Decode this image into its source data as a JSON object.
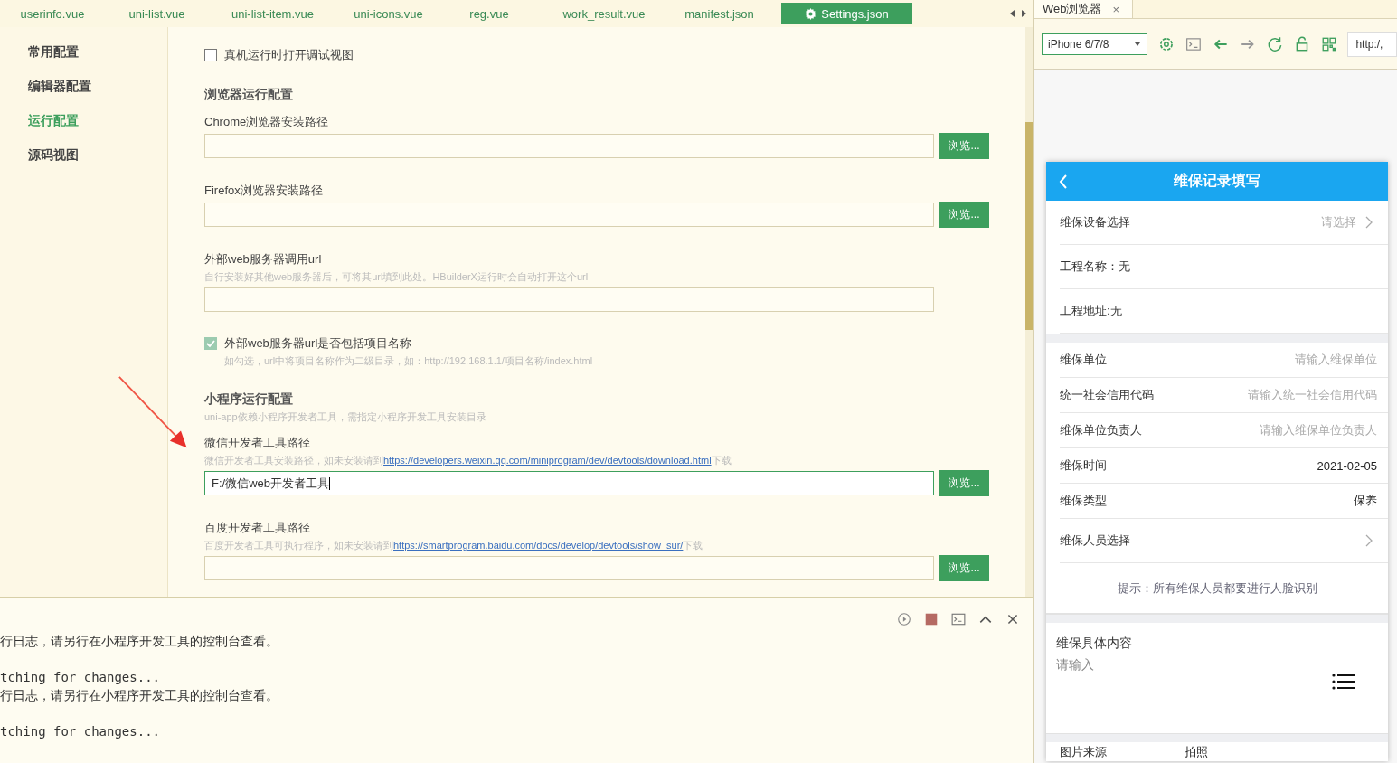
{
  "editor_tabs": [
    {
      "label": "userinfo.vue",
      "selected": false
    },
    {
      "label": "uni-list.vue",
      "selected": false
    },
    {
      "label": "uni-list-item.vue",
      "selected": false
    },
    {
      "label": "uni-icons.vue",
      "selected": false
    },
    {
      "label": "reg.vue",
      "selected": false
    },
    {
      "label": "work_result.vue",
      "selected": false
    },
    {
      "label": "manifest.json",
      "selected": false
    },
    {
      "label": "Settings.json",
      "selected": true
    }
  ],
  "sidebar": {
    "items": [
      {
        "label": "常用配置",
        "selected": false
      },
      {
        "label": "编辑器配置",
        "selected": false
      },
      {
        "label": "运行配置",
        "selected": true
      },
      {
        "label": "源码视图",
        "selected": false
      }
    ]
  },
  "settings": [
    {
      "kind": "checkbox",
      "label": "真机运行时打开调试视图",
      "checked": false
    },
    {
      "kind": "heading",
      "label": "浏览器运行配置"
    },
    {
      "kind": "path",
      "label": "Chrome浏览器安装路径",
      "focused": false,
      "button": "浏览..."
    },
    {
      "kind": "path",
      "label": "Firefox浏览器安装路径",
      "focused": false,
      "button": "浏览..."
    },
    {
      "kind": "field",
      "label": "外部web服务器调用url",
      "hint": "自行安装好其他web服务器后，可将其url填到此处。HBuilderX运行时会自动打开这个url",
      "focused": false
    },
    {
      "kind": "checkbox",
      "label": "外部web服务器url是否包括项目名称",
      "checked": true,
      "hint": "如勾选，url中将项目名称作为二级目录，如：http://192.168.1.1/项目名称/index.html"
    },
    {
      "kind": "heading",
      "label": "小程序运行配置",
      "hint": "uni-app依赖小程序开发者工具，需指定小程序开发工具安装目录"
    },
    {
      "kind": "path",
      "label": "微信开发者工具路径",
      "hint": "微信开发者工具安装路径，如未安装请到",
      "link": "https://developers.weixin.qq.com/miniprogram/dev/devtools/download.html",
      "hint_end": "下载",
      "value": "F:/微信web开发者工具",
      "focused": true,
      "button": "浏览..."
    },
    {
      "kind": "path",
      "label": "百度开发者工具路径",
      "hint": "百度开发者工具可执行程序，如未安装请到",
      "link": "https://smartprogram.baidu.com/docs/develop/devtools/show_sur/",
      "hint_end": "下载",
      "focused": false,
      "button": "浏览..."
    }
  ],
  "console": {
    "lines": [
      {
        "text": "行日志，请另行在小程序开发工具的控制台查看。",
        "kind": "log"
      },
      {
        "text": "tching for changes...",
        "kind": "mono"
      },
      {
        "text": "行日志，请另行在小程序开发工具的控制台查看。",
        "kind": "log"
      },
      {
        "text": "tching for changes...",
        "kind": "mono"
      }
    ]
  },
  "browser": {
    "tab": {
      "label": "Web浏览器",
      "close": "×"
    },
    "device": "iPhone 6/7/8",
    "url": "http:/,",
    "phone": {
      "title": "维保记录填写",
      "rows": [
        {
          "kind": "picker",
          "label": "维保设备选择",
          "placeholder": "请选择"
        },
        {
          "kind": "text",
          "label": "工程名称：无"
        },
        {
          "kind": "text",
          "label": "工程地址:无"
        },
        {
          "kind": "gap"
        },
        {
          "kind": "input",
          "label": "维保单位",
          "placeholder": "请输入维保单位"
        },
        {
          "kind": "input",
          "label": "统一社会信用代码",
          "placeholder": "请输入统一社会信用代码"
        },
        {
          "kind": "input",
          "label": "维保单位负责人",
          "placeholder": "请输入维保单位负责人"
        },
        {
          "kind": "value",
          "label": "维保时间",
          "value": "2021-02-05"
        },
        {
          "kind": "value",
          "label": "维保类型",
          "value": "保养"
        },
        {
          "kind": "picker",
          "label": "维保人员选择"
        },
        {
          "kind": "notice",
          "label": "提示：所有维保人员都要进行人脸识别"
        },
        {
          "kind": "gap"
        },
        {
          "kind": "textarea",
          "label": "维保具体内容",
          "placeholder": "请输入"
        },
        {
          "kind": "gap"
        },
        {
          "kind": "value2",
          "label": "图片来源",
          "value": "拍照"
        }
      ]
    }
  }
}
